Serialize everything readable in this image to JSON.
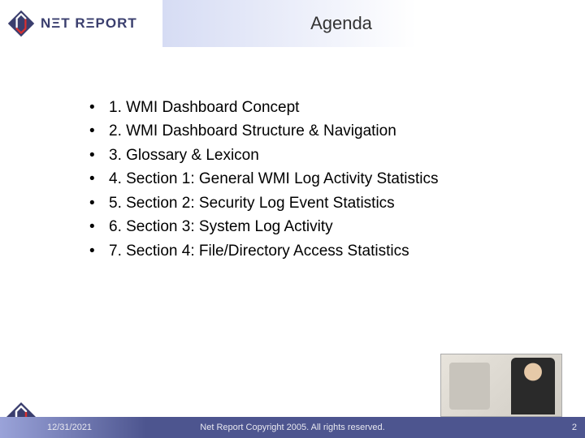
{
  "header": {
    "logo_text": "NΞT RΞPORT",
    "title": "Agenda"
  },
  "agenda": {
    "items": [
      "1. WMI Dashboard Concept",
      "2. WMI Dashboard Structure & Navigation",
      "3. Glossary & Lexicon",
      "4. Section 1: General WMI Log Activity Statistics",
      "5. Section 2: Security Log Event Statistics",
      "6. Section 3: System Log Activity",
      "7. Section 4: File/Directory Access Statistics"
    ]
  },
  "footer": {
    "date": "12/31/2021",
    "copyright": "Net Report Copyright 2005. All rights reserved.",
    "page": "2"
  }
}
